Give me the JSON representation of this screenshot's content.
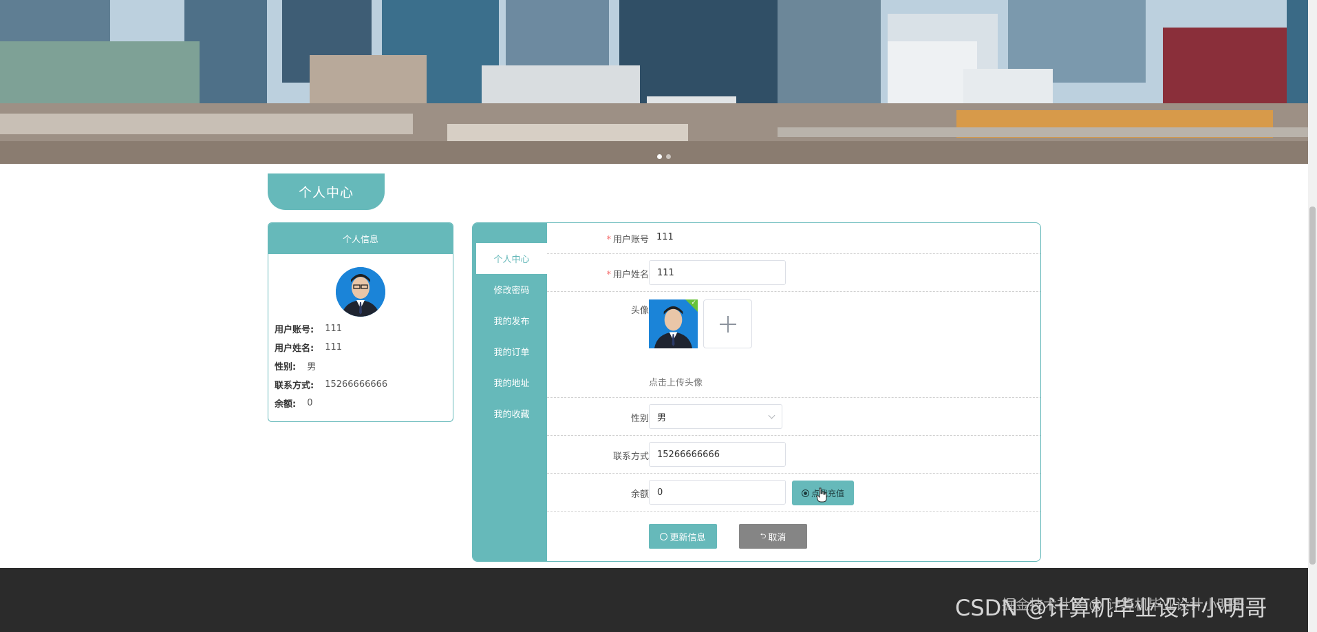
{
  "page": {
    "title": "个人中心"
  },
  "profile_card": {
    "header": "个人信息",
    "fields": [
      {
        "label": "用户账号:",
        "value": "111"
      },
      {
        "label": "用户姓名:",
        "value": "111"
      },
      {
        "label": "性别:",
        "value": "男"
      },
      {
        "label": "联系方式:",
        "value": "15266666666"
      },
      {
        "label": "余额:",
        "value": "0"
      }
    ]
  },
  "side_menu": {
    "items": [
      {
        "label": "个人中心",
        "active": true
      },
      {
        "label": "修改密码",
        "active": false
      },
      {
        "label": "我的发布",
        "active": false
      },
      {
        "label": "我的订单",
        "active": false
      },
      {
        "label": "我的地址",
        "active": false
      },
      {
        "label": "我的收藏",
        "active": false
      }
    ]
  },
  "form": {
    "account": {
      "label": "用户账号",
      "value": "111",
      "required": true
    },
    "name": {
      "label": "用户姓名",
      "value": "111",
      "required": true
    },
    "avatar": {
      "label": "头像",
      "upload_tip": "点击上传头像"
    },
    "gender": {
      "label": "性别",
      "value": "男"
    },
    "phone": {
      "label": "联系方式",
      "value": "15266666666"
    },
    "balance": {
      "label": "余额",
      "value": "0",
      "recharge_label": "点我充值"
    },
    "update_label": "更新信息",
    "cancel_label": "取消"
  },
  "footer": {
    "watermark": "CSDN @计算机毕业设计小明哥",
    "watermark_overlay": "掘金技术社区 @ 计算机毕业设计小明哥"
  },
  "colors": {
    "accent": "#66b9ba",
    "footer_bg": "#2b2b2b",
    "cancel_bg": "#858585",
    "required": "#f56c6c"
  }
}
